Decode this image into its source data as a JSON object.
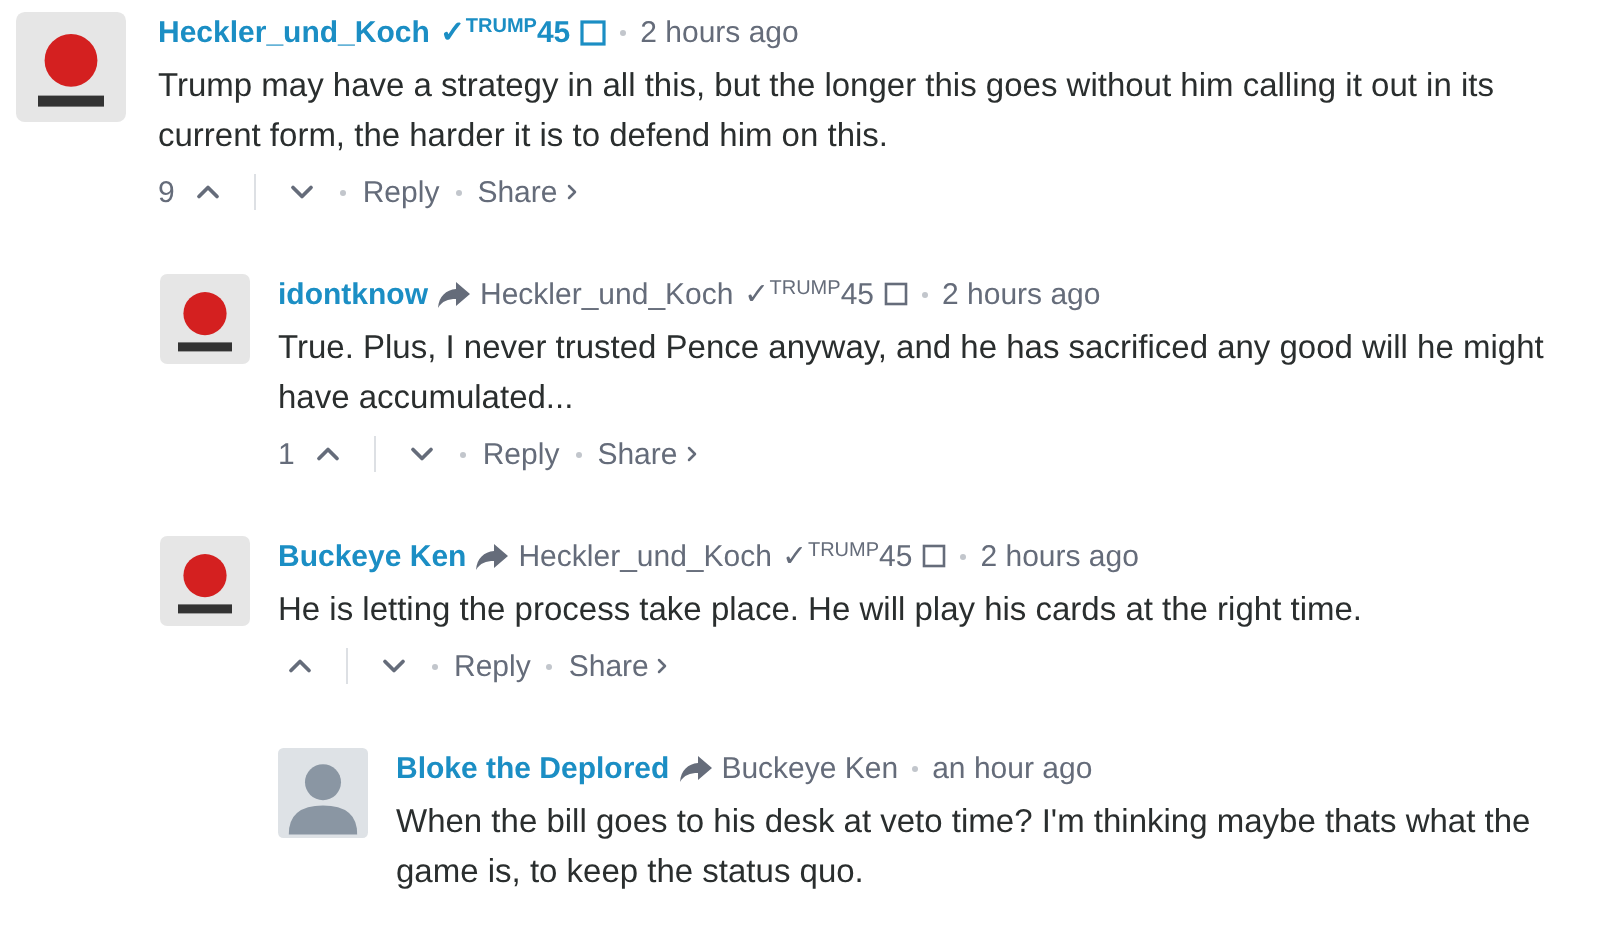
{
  "comments": [
    {
      "author": "Heckler_und_Koch",
      "author_badge": "✓$^{TRUMP}$45",
      "default_avatar": false,
      "time": "2 hours ago",
      "body": "Trump may have a strategy in all this, but the longer this goes without him calling it out in its current form, the harder it is to defend him on this.",
      "votes": "9",
      "actions": [
        "Reply",
        "Share"
      ],
      "children": [
        {
          "author": "idontknow",
          "reply_to": "Heckler_und_Koch",
          "reply_to_badge": "✓$^{TRUMP}$45",
          "default_avatar": false,
          "time": "2 hours ago",
          "body": "True. Plus, I never trusted Pence anyway, and he has sacrificed any good will he might have accumulated...",
          "votes": "1",
          "actions": [
            "Reply",
            "Share"
          ]
        },
        {
          "author": "Buckeye Ken",
          "reply_to": "Heckler_und_Koch",
          "reply_to_badge": "✓$^{TRUMP}$45",
          "default_avatar": false,
          "time": "2 hours ago",
          "body": "He is letting the process take place. He will play his cards at the right time.",
          "actions": [
            "Reply",
            "Share"
          ],
          "children": [
            {
              "author": "Bloke the Deplored",
              "reply_to": "Buckeye Ken",
              "default_avatar": true,
              "time": "an hour ago",
              "body": "When the bill goes to his desk at veto time? I'm thinking maybe thats what the game is, to keep the status quo."
            }
          ]
        }
      ]
    }
  ]
}
